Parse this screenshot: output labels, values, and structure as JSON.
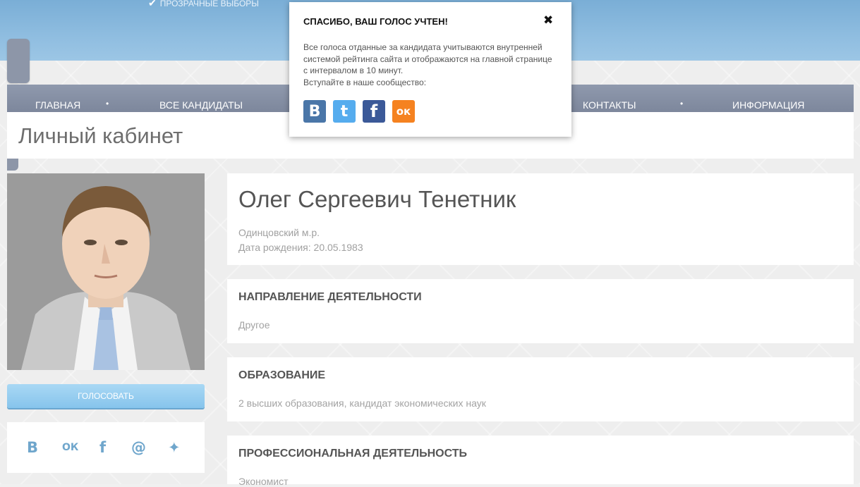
{
  "header": {
    "slogan": "ПРОЗРАЧНЫЕ ВЫБОРЫ",
    "check_icon": "✔"
  },
  "nav": {
    "items": [
      "ГЛАВНАЯ",
      "ВСЕ КАНДИДАТЫ",
      "КОНТАКТЫ",
      "ИНФОРМАЦИЯ"
    ],
    "separator": "•"
  },
  "page_title": "Личный кабинет",
  "profile": {
    "name": "Олег Сергеевич Тенетник",
    "region": "Одинцовский м.р.",
    "birth_date": "Дата рождения: 20.05.1983"
  },
  "vote_button": "ГОЛОСОВАТЬ",
  "share": {
    "icons": [
      "vk-icon",
      "odnoklassniki-icon",
      "facebook-icon",
      "mail-icon",
      "twitter-icon"
    ],
    "glyphs": [
      "В",
      "ОК",
      "f",
      "@",
      "✦"
    ]
  },
  "sections": [
    {
      "title": "НАПРАВЛЕНИЕ ДЕЯТЕЛЬНОСТИ",
      "text": "Другое"
    },
    {
      "title": "ОБРАЗОВАНИЕ",
      "text": "2 высших образования, кандидат экономических наук"
    },
    {
      "title": "ПРОФЕССИОНАЛЬНАЯ ДЕЯТЕЛЬНОСТЬ",
      "text": "Экономист"
    }
  ],
  "popup": {
    "title": "СПАСИБО, ВАШ ГОЛОС УЧТЕН!",
    "close": "✖",
    "line1": "Все голоса отданные за кандидата учитываются внутренней системой рейтинга сайта и отображаются на главной странице с интервалом в 10 минут.",
    "line2": "Вступайте в наше сообщество:",
    "social_glyphs": [
      "В",
      "t",
      "f",
      "ок"
    ]
  },
  "colors": {
    "vk": "#4a76a8",
    "twitter": "#55acee",
    "facebook": "#3b5998",
    "odnoklassniki": "#f58220",
    "accent": "#86c4ec"
  }
}
